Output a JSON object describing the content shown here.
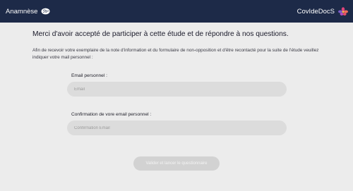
{
  "header": {
    "app_name": "Anamnèse",
    "logo_icon": "brain-icon",
    "brand_name": "CovIdeDocS",
    "brand_icon": "flower-icon",
    "background_color": "#1d2a48"
  },
  "main": {
    "heading": "Merci d'avoir accepté de participer à cette étude et de répondre à nos questions.",
    "intro": "Afin de recevoir votre exemplaire de la note d'information et du formulaire de non-opposition et d'être recontacté pour la suite de l'étude veuillez indiquer votre mail personnel :",
    "email": {
      "label": "Email personnel :",
      "placeholder": "Email",
      "value": ""
    },
    "confirm_email": {
      "label": "Confirmation de vore email personnel :",
      "placeholder": "Confirmation Email",
      "value": ""
    },
    "submit_label": "Valider et lancer le questionnaire"
  }
}
